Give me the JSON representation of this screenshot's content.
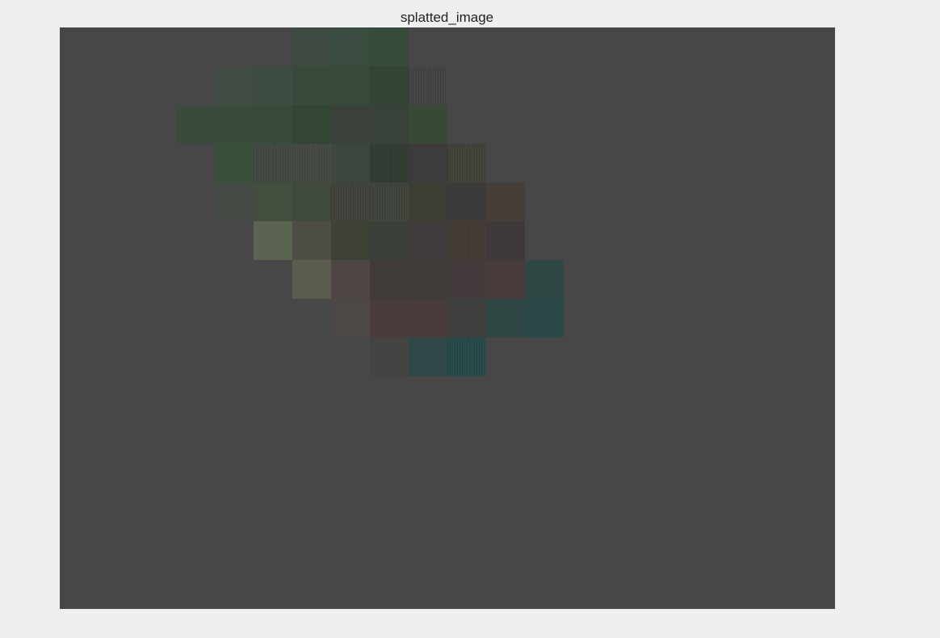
{
  "figure": {
    "title": "splatted_image",
    "background_color": "#474747",
    "page_color": "#eeeff1"
  },
  "grid": {
    "columns": 20,
    "rows": 15
  },
  "tiles": [
    {
      "col": 6,
      "row": 0,
      "color": "#3f4a41"
    },
    {
      "col": 7,
      "row": 0,
      "color": "#3a4b3f"
    },
    {
      "col": 8,
      "row": 0,
      "color": "#374b3a"
    },
    {
      "col": 4,
      "row": 1,
      "color": "#434b45"
    },
    {
      "col": 5,
      "row": 1,
      "color": "#3d4b40"
    },
    {
      "col": 6,
      "row": 1,
      "color": "#394a3c"
    },
    {
      "col": 7,
      "row": 1,
      "color": "#384a3b"
    },
    {
      "col": 8,
      "row": 1,
      "color": "#334335"
    },
    {
      "col": 9,
      "row": 1,
      "color": "#444745",
      "striped": true
    },
    {
      "col": 3,
      "row": 2,
      "color": "#3b4a3d"
    },
    {
      "col": 4,
      "row": 2,
      "color": "#3a4b3c"
    },
    {
      "col": 5,
      "row": 2,
      "color": "#384a3b"
    },
    {
      "col": 6,
      "row": 2,
      "color": "#334535"
    },
    {
      "col": 7,
      "row": 2,
      "color": "#3b423c"
    },
    {
      "col": 8,
      "row": 2,
      "color": "#384239"
    },
    {
      "col": 9,
      "row": 2,
      "color": "#384a37"
    },
    {
      "col": 4,
      "row": 3,
      "color": "#3a4f39"
    },
    {
      "col": 5,
      "row": 3,
      "color": "#434b43",
      "striped": true
    },
    {
      "col": 6,
      "row": 3,
      "color": "#464c45",
      "striped": true
    },
    {
      "col": 7,
      "row": 3,
      "color": "#3d473d"
    },
    {
      "col": 8,
      "row": 3,
      "color": "#353e34",
      "striped": true
    },
    {
      "col": 9,
      "row": 3,
      "color": "#3e3b3c"
    },
    {
      "col": 10,
      "row": 3,
      "color": "#44443b",
      "striped": true
    },
    {
      "col": 4,
      "row": 4,
      "color": "#444a44"
    },
    {
      "col": 5,
      "row": 4,
      "color": "#434e3f"
    },
    {
      "col": 6,
      "row": 4,
      "color": "#3f4a3c"
    },
    {
      "col": 7,
      "row": 4,
      "color": "#42443d",
      "striped": true
    },
    {
      "col": 8,
      "row": 4,
      "color": "#42463f",
      "striped": true
    },
    {
      "col": 9,
      "row": 4,
      "color": "#3a3e33"
    },
    {
      "col": 10,
      "row": 4,
      "color": "#3d3a3a"
    },
    {
      "col": 11,
      "row": 4,
      "color": "#463e39"
    },
    {
      "col": 5,
      "row": 5,
      "color": "#5a6450"
    },
    {
      "col": 6,
      "row": 5,
      "color": "#4e4e47"
    },
    {
      "col": 7,
      "row": 5,
      "color": "#3e4236"
    },
    {
      "col": 8,
      "row": 5,
      "color": "#3b3f3a"
    },
    {
      "col": 9,
      "row": 5,
      "color": "#403c3b"
    },
    {
      "col": 10,
      "row": 5,
      "color": "#453c36",
      "striped": true
    },
    {
      "col": 11,
      "row": 5,
      "color": "#3f3a39"
    },
    {
      "col": 6,
      "row": 6,
      "color": "#5c5c4e"
    },
    {
      "col": 7,
      "row": 6,
      "color": "#4d4643"
    },
    {
      "col": 8,
      "row": 6,
      "color": "#413b37"
    },
    {
      "col": 9,
      "row": 6,
      "color": "#3f3b38"
    },
    {
      "col": 10,
      "row": 6,
      "color": "#433a3c"
    },
    {
      "col": 11,
      "row": 6,
      "color": "#473b3c"
    },
    {
      "col": 12,
      "row": 6,
      "color": "#2f4846"
    },
    {
      "col": 7,
      "row": 7,
      "color": "#4d4846"
    },
    {
      "col": 8,
      "row": 7,
      "color": "#483c3d"
    },
    {
      "col": 9,
      "row": 7,
      "color": "#473b3c"
    },
    {
      "col": 10,
      "row": 7,
      "color": "#3f3f3f"
    },
    {
      "col": 11,
      "row": 7,
      "color": "#2f4644"
    },
    {
      "col": 12,
      "row": 7,
      "color": "#2a4848"
    },
    {
      "col": 8,
      "row": 8,
      "color": "#444542"
    },
    {
      "col": 9,
      "row": 8,
      "color": "#314848"
    },
    {
      "col": 10,
      "row": 8,
      "color": "#2b4c4c",
      "striped": true
    }
  ]
}
